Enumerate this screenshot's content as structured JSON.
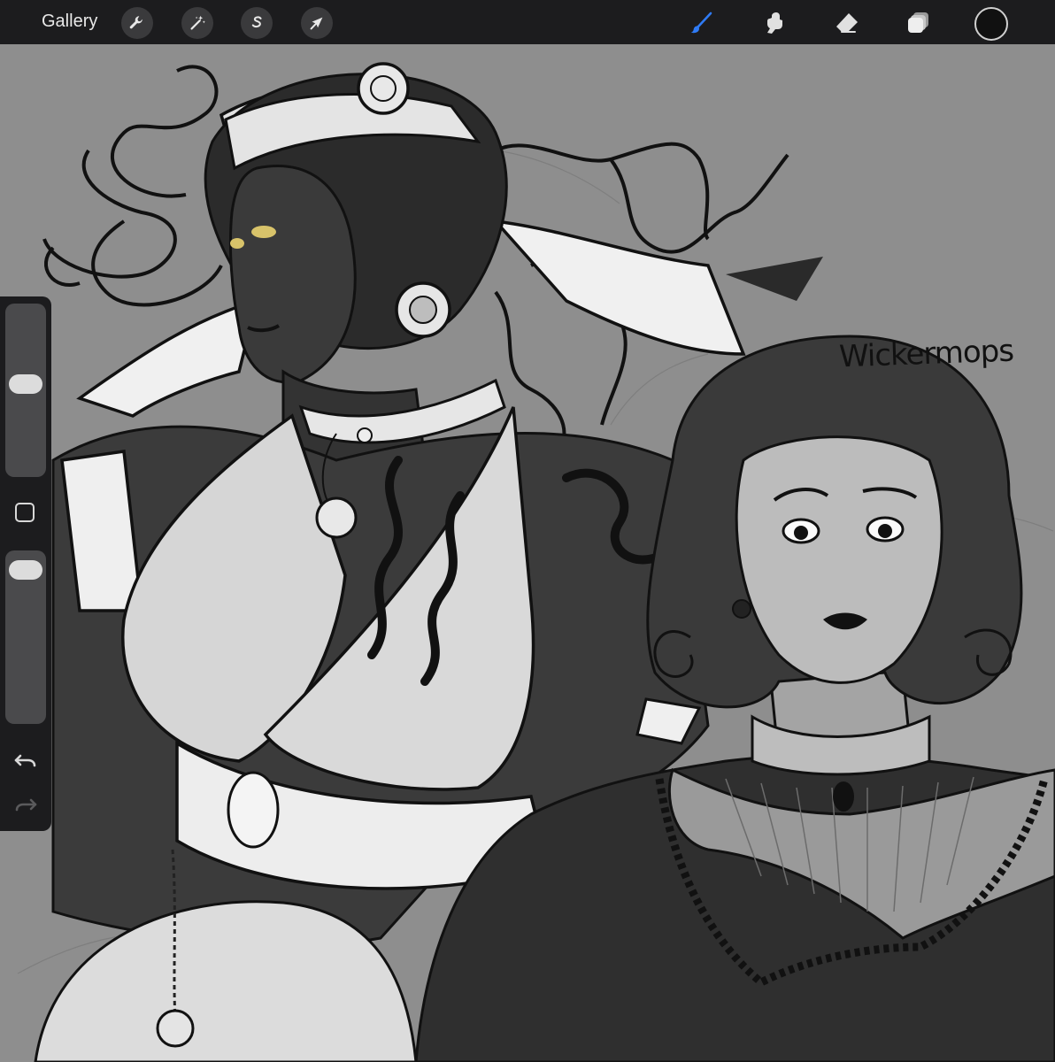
{
  "toolbar": {
    "gallery_label": "Gallery",
    "left_tools": [
      "wrench-icon",
      "magic-wand-icon",
      "selection-s-icon",
      "transform-arrow-icon"
    ],
    "right_tools": [
      "brush-icon",
      "smudge-icon",
      "eraser-icon",
      "layers-icon"
    ],
    "active_tool": "brush",
    "active_color": "#111111",
    "accent": "#2f7bf5"
  },
  "sidebar": {
    "brush_size": 0.54,
    "brush_opacity": 0.96
  },
  "canvas": {
    "signature_text": "Wickermops"
  }
}
